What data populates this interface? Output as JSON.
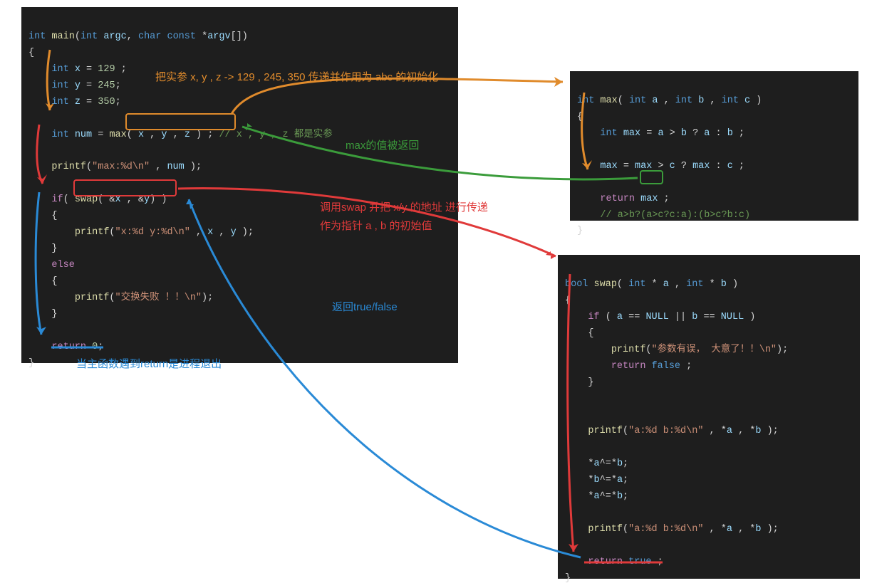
{
  "main": {
    "l1": "int main(int argc, char const *argv[])",
    "l2": "{",
    "l3": "    int x = 129 ;",
    "l4": "    int y = 245;",
    "l5": "    int z = 350;",
    "l6": "",
    "l7": "    int num = max( x , y , z ) ; // x , y , z 都是实参",
    "l8": "",
    "l9": "    printf(\"max:%d\\n\" , num );",
    "l10": "",
    "l11": "    if( swap( &x , &y) )",
    "l12": "    {",
    "l13": "        printf(\"x:%d y:%d\\n\" , x , y );",
    "l14": "    }",
    "l15": "    else",
    "l16": "    {",
    "l17": "        printf(\"交换失败 ！！\\n\");",
    "l18": "    }",
    "l19": "",
    "l20": "    return 0;",
    "l21": "}"
  },
  "maxfn": {
    "l1": "int max( int a , int b , int c )",
    "l2": "{",
    "l3": "    int max = a > b ? a : b ;",
    "l4": "",
    "l5": "    max = max > c ? max : c ;",
    "l6": "",
    "l7": "    return max ;",
    "l8": "    // a>b?(a>c?c:a):(b>c?b:c)",
    "l9": "}"
  },
  "swapfn": {
    "l1": "bool swap( int * a , int * b )",
    "l2": "{",
    "l3": "    if ( a == NULL || b == NULL )",
    "l4": "    {",
    "l5": "        printf(\"参数有误， 大意了！！\\n\");",
    "l6": "        return false ;",
    "l7": "    }",
    "l8": "",
    "l9": "",
    "l10": "    printf(\"a:%d b:%d\\n\" , *a , *b );",
    "l11": "",
    "l12": "    *a^=*b;",
    "l13": "    *b^=*a;",
    "l14": "    *a^=*b;",
    "l15": "",
    "l16": "    printf(\"a:%d b:%d\\n\" , *a , *b );",
    "l17": "",
    "l18": "    return true ;",
    "l19": "}"
  },
  "annot": {
    "orange": "把实参 x, y , z -> 129 , 245, 350 传递并作用为 abc 的初始化",
    "green": "max的值被返回",
    "red1": "调用swap 并把 x/y 的地址 进行传递",
    "red2": "作为指针 a , b 的初始值",
    "blue1": "返回true/false",
    "blue2": "当主函数遇到return是进程退出"
  }
}
